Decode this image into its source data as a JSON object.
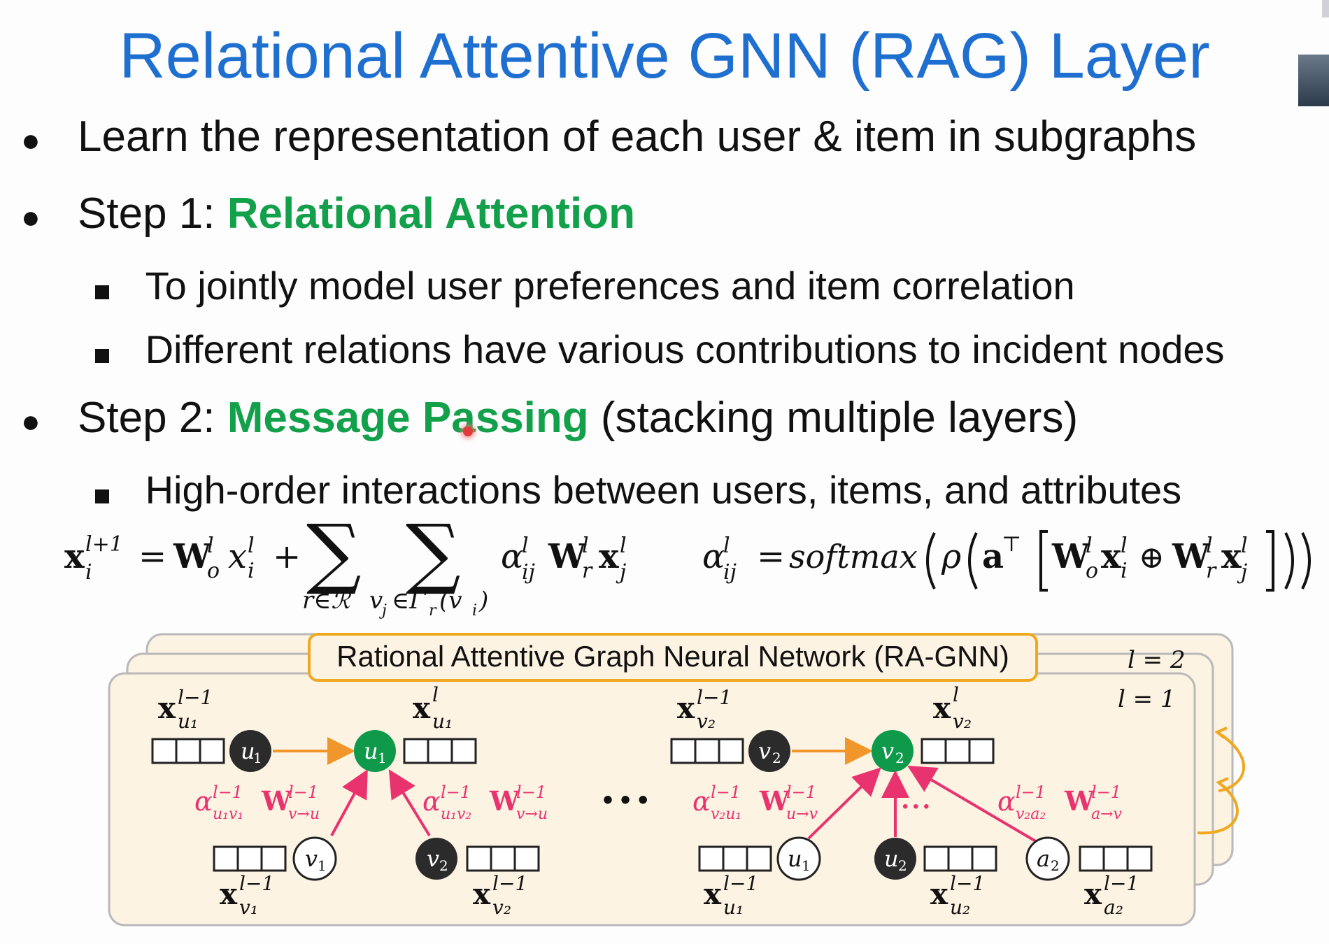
{
  "title": "Relational Attentive GNN (RAG) Layer",
  "bullets": {
    "b1": "Learn the representation of each user & item in subgraphs",
    "b2_prefix": "Step 1: ",
    "b2_green": "Relational Attention",
    "b2_sub1": "To jointly model user preferences and item correlation",
    "b2_sub2": "Different relations have various contributions to incident nodes",
    "b3_prefix": "Step 2: ",
    "b3_green": "Message Passing",
    "b3_suffix": " (stacking multiple layers)",
    "b3_sub1": "High-order interactions between users, items, and attributes"
  },
  "formula": {
    "lhs": "x",
    "lhs_sup": "l+1",
    "lhs_sub": "i",
    "eq": "=",
    "W_o": "W",
    "sup_l": "l",
    "sub_o": "o",
    "x": "x",
    "sub_i": "i",
    "plus": "+",
    "sigma": "∑",
    "sum1_under": "r∈ℛ",
    "sum2_under": "v",
    "sum2_under_j": "j",
    "sum2_under_rest": "∈Γ",
    "sum2_under_r": "r",
    "sum2_under_paren": "(v",
    "sum2_under_close": ")",
    "alpha": "α",
    "sub_ij": "ij",
    "sub_r": "r",
    "sub_j": "j",
    "softmax": "softmax",
    "rho": "ρ",
    "a": "a",
    "top": "⊤",
    "oplus": "⊕"
  },
  "diagram": {
    "box_title": "Rational Attentive Graph Neural Network (RA-GNN)",
    "layer2": "l = 2",
    "layer1": "l = 1",
    "ellipsis": "• • •",
    "small_ellipsis": "• • •",
    "colors": {
      "panel": "#fdf3e3",
      "panel_border": "#b9b9b9",
      "title_border": "#f0a820",
      "orange": "#f0962a",
      "pink": "#e8336e",
      "green_node": "#0e9a4a",
      "dark_node": "#2b2b2b"
    },
    "labels": {
      "x": "x",
      "l_minus_1": "l−1",
      "l": "l",
      "u1": "u",
      "v1": "v",
      "v2": "v",
      "u2": "u",
      "a2": "a",
      "one": "1",
      "two": "2",
      "alpha": "α",
      "W": "W",
      "v_to_u": "v→u",
      "u_to_v": "u→v",
      "a_to_v": "a→v",
      "u1v1": "u₁v₁",
      "u1v2": "u₁v₂",
      "v2u1": "v₂u₁",
      "v2a2": "v₂a₂",
      "u1_sub": "u₁",
      "v1_sub": "v₁",
      "v2_sub": "v₂",
      "u2_sub": "u₂",
      "a2_sub": "a₂"
    }
  }
}
